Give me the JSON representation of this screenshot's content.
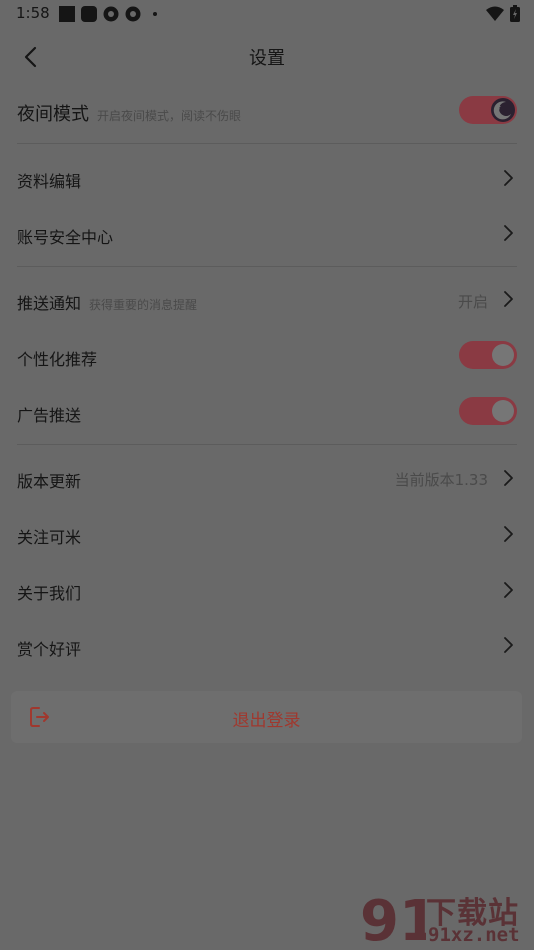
{
  "status_bar": {
    "time": "1:58"
  },
  "header": {
    "title": "设置"
  },
  "night_mode": {
    "label": "夜间模式",
    "sub": "开启夜间模式，阅读不伤眼",
    "enabled": true
  },
  "section1": {
    "items": [
      {
        "label": "资料编辑"
      },
      {
        "label": "账号安全中心"
      }
    ]
  },
  "section2": {
    "push": {
      "label": "推送通知",
      "sub": "获得重要的消息提醒",
      "value": "开启"
    },
    "personalized": {
      "label": "个性化推荐",
      "enabled": true
    },
    "ads": {
      "label": "广告推送",
      "enabled": true
    }
  },
  "section3": {
    "items": [
      {
        "label": "版本更新",
        "value": "当前版本1.33"
      },
      {
        "label": "关注可米"
      },
      {
        "label": "关于我们"
      },
      {
        "label": "赏个好评"
      }
    ]
  },
  "logout": {
    "label": "退出登录"
  },
  "watermark": {
    "text": "下载站",
    "url": "91xz.net"
  },
  "colors": {
    "accent": "#8a3a43",
    "logout_text": "#a0382e",
    "background": "#696969"
  }
}
